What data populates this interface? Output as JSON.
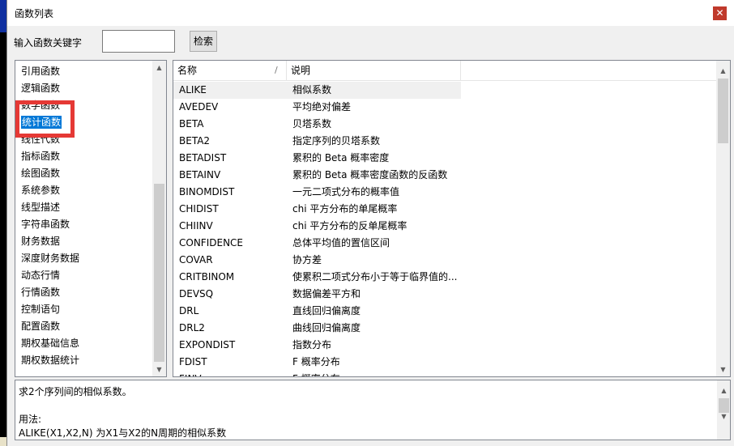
{
  "window": {
    "title": "函数列表",
    "close_label": "✕"
  },
  "search": {
    "label": "输入函数关键字",
    "value": "",
    "button_label": "检索"
  },
  "categories": {
    "items": [
      {
        "label": "引用函数",
        "selected": false
      },
      {
        "label": "逻辑函数",
        "selected": false
      },
      {
        "label": "数学函数",
        "selected": false
      },
      {
        "label": "统计函数",
        "selected": true
      },
      {
        "label": "线性代数",
        "selected": false
      },
      {
        "label": "指标函数",
        "selected": false
      },
      {
        "label": "绘图函数",
        "selected": false
      },
      {
        "label": "系统参数",
        "selected": false
      },
      {
        "label": "线型描述",
        "selected": false
      },
      {
        "label": "字符串函数",
        "selected": false
      },
      {
        "label": "财务数据",
        "selected": false
      },
      {
        "label": "深度财务数据",
        "selected": false
      },
      {
        "label": "动态行情",
        "selected": false
      },
      {
        "label": "行情函数",
        "selected": false
      },
      {
        "label": "控制语句",
        "selected": false
      },
      {
        "label": "配置函数",
        "selected": false
      },
      {
        "label": "期权基础信息",
        "selected": false
      },
      {
        "label": "期权数据统计",
        "selected": false
      }
    ]
  },
  "table": {
    "columns": [
      "名称",
      "说明"
    ],
    "sort_indicator": "/",
    "rows": [
      {
        "name": "ALIKE",
        "desc": "相似系数",
        "selected": true
      },
      {
        "name": "AVEDEV",
        "desc": "平均绝对偏差"
      },
      {
        "name": "BETA",
        "desc": "贝塔系数"
      },
      {
        "name": "BETA2",
        "desc": "指定序列的贝塔系数"
      },
      {
        "name": "BETADIST",
        "desc": "累积的 Beta 概率密度"
      },
      {
        "name": "BETAINV",
        "desc": "累积的 Beta 概率密度函数的反函数"
      },
      {
        "name": "BINOMDIST",
        "desc": "一元二项式分布的概率值"
      },
      {
        "name": "CHIDIST",
        "desc": "chi 平方分布的单尾概率"
      },
      {
        "name": "CHIINV",
        "desc": "chi 平方分布的反单尾概率"
      },
      {
        "name": "CONFIDENCE",
        "desc": "总体平均值的置信区间"
      },
      {
        "name": "COVAR",
        "desc": "协方差"
      },
      {
        "name": "CRITBINOM",
        "desc": "使累积二项式分布小于等于临界值的..."
      },
      {
        "name": "DEVSQ",
        "desc": "数据偏差平方和"
      },
      {
        "name": "DRL",
        "desc": "直线回归偏离度"
      },
      {
        "name": "DRL2",
        "desc": "曲线回归偏离度"
      },
      {
        "name": "EXPONDIST",
        "desc": "指数分布"
      },
      {
        "name": "FDIST",
        "desc": "F 概率分布"
      },
      {
        "name": "FINV",
        "desc": "F 概率分布..."
      }
    ]
  },
  "description": {
    "lines": [
      "求2个序列间的相似系数。",
      "",
      "用法:",
      "ALIKE(X1,X2,N) 为X1与X2的N周期的相似系数"
    ]
  },
  "colors": {
    "selection": "#0078d7",
    "highlight_box": "#e53935"
  }
}
